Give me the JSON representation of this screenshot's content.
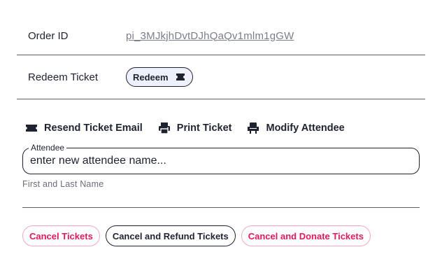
{
  "order": {
    "label": "Order ID",
    "value": "pi_3MJkjhDvtDJhQaQv1mlm1gGW"
  },
  "redeem": {
    "label": "Redeem Ticket",
    "button_label": "Redeem",
    "button_icon": "ticket-icon"
  },
  "actions": [
    {
      "label": "Resend Ticket Email",
      "icon": "ticket-icon"
    },
    {
      "label": "Print Ticket",
      "icon": "printer-icon"
    },
    {
      "label": "Modify Attendee",
      "icon": "seat-icon"
    }
  ],
  "attendee": {
    "legend": "Attendee",
    "placeholder": "enter new attendee name...",
    "helper": "First and Last Name"
  },
  "buttons": {
    "cancel": "Cancel Tickets",
    "cancel_refund": "Cancel and Refund Tickets",
    "cancel_donate": "Cancel and Donate Tickets"
  },
  "colors": {
    "accent_pink": "#e0195b",
    "text_dark": "#1f2330",
    "redeem_bg": "#eef0fb"
  }
}
